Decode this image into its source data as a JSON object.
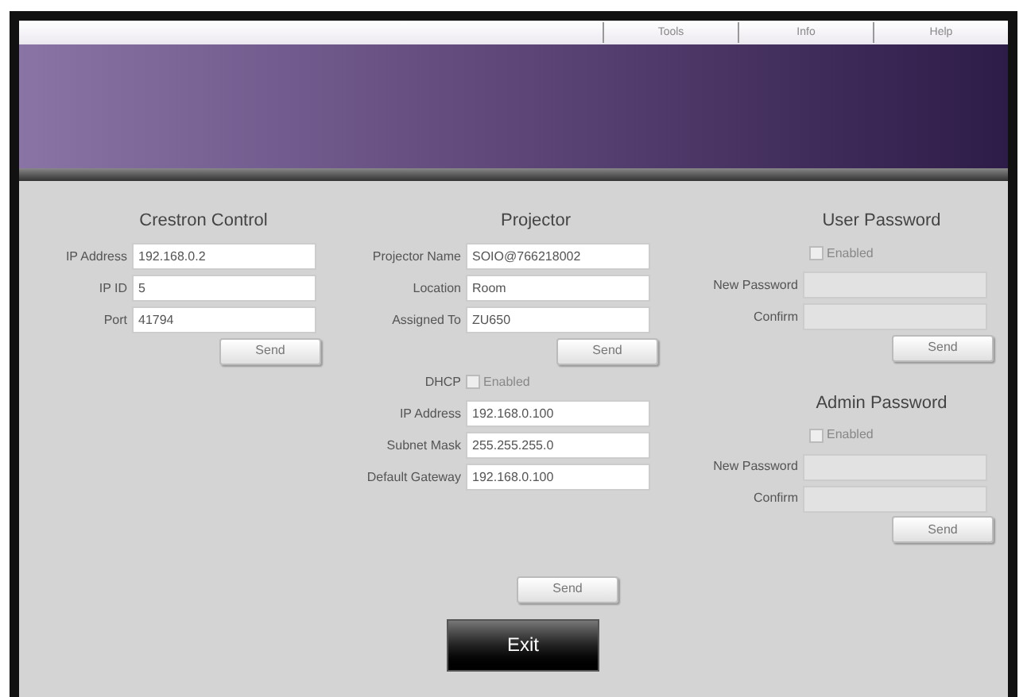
{
  "menu": [
    "Tools",
    "Info",
    "Help"
  ],
  "crestron": {
    "title": "Crestron Control",
    "fields": [
      {
        "label": "IP Address",
        "value": "192.168.0.2"
      },
      {
        "label": "IP ID",
        "value": "5"
      },
      {
        "label": "Port",
        "value": "41794"
      }
    ],
    "send": "Send"
  },
  "projector": {
    "title": "Projector",
    "fields": [
      {
        "label": "Projector Name",
        "value": "SOIO@766218002"
      },
      {
        "label": "Location",
        "value": "Room"
      },
      {
        "label": "Assigned To",
        "value": "ZU650"
      }
    ],
    "send": "Send",
    "dhcp": {
      "label": "DHCP",
      "option": "Enabled",
      "checked": false
    },
    "network": [
      {
        "label": "IP Address",
        "value": "192.168.0.100"
      },
      {
        "label": "Subnet Mask",
        "value": "255.255.255.0"
      },
      {
        "label": "Default Gateway",
        "value": "192.168.0.100"
      }
    ],
    "network_send": "Send"
  },
  "passwords": [
    {
      "title": "User Password",
      "enabled_label": "Enabled",
      "checked": false,
      "fields": [
        "New Password",
        "Confirm"
      ],
      "send": "Send"
    },
    {
      "title": "Admin Password",
      "enabled_label": "Enabled",
      "checked": false,
      "fields": [
        "New Password",
        "Confirm"
      ],
      "send": "Send"
    }
  ],
  "exit": "Exit"
}
